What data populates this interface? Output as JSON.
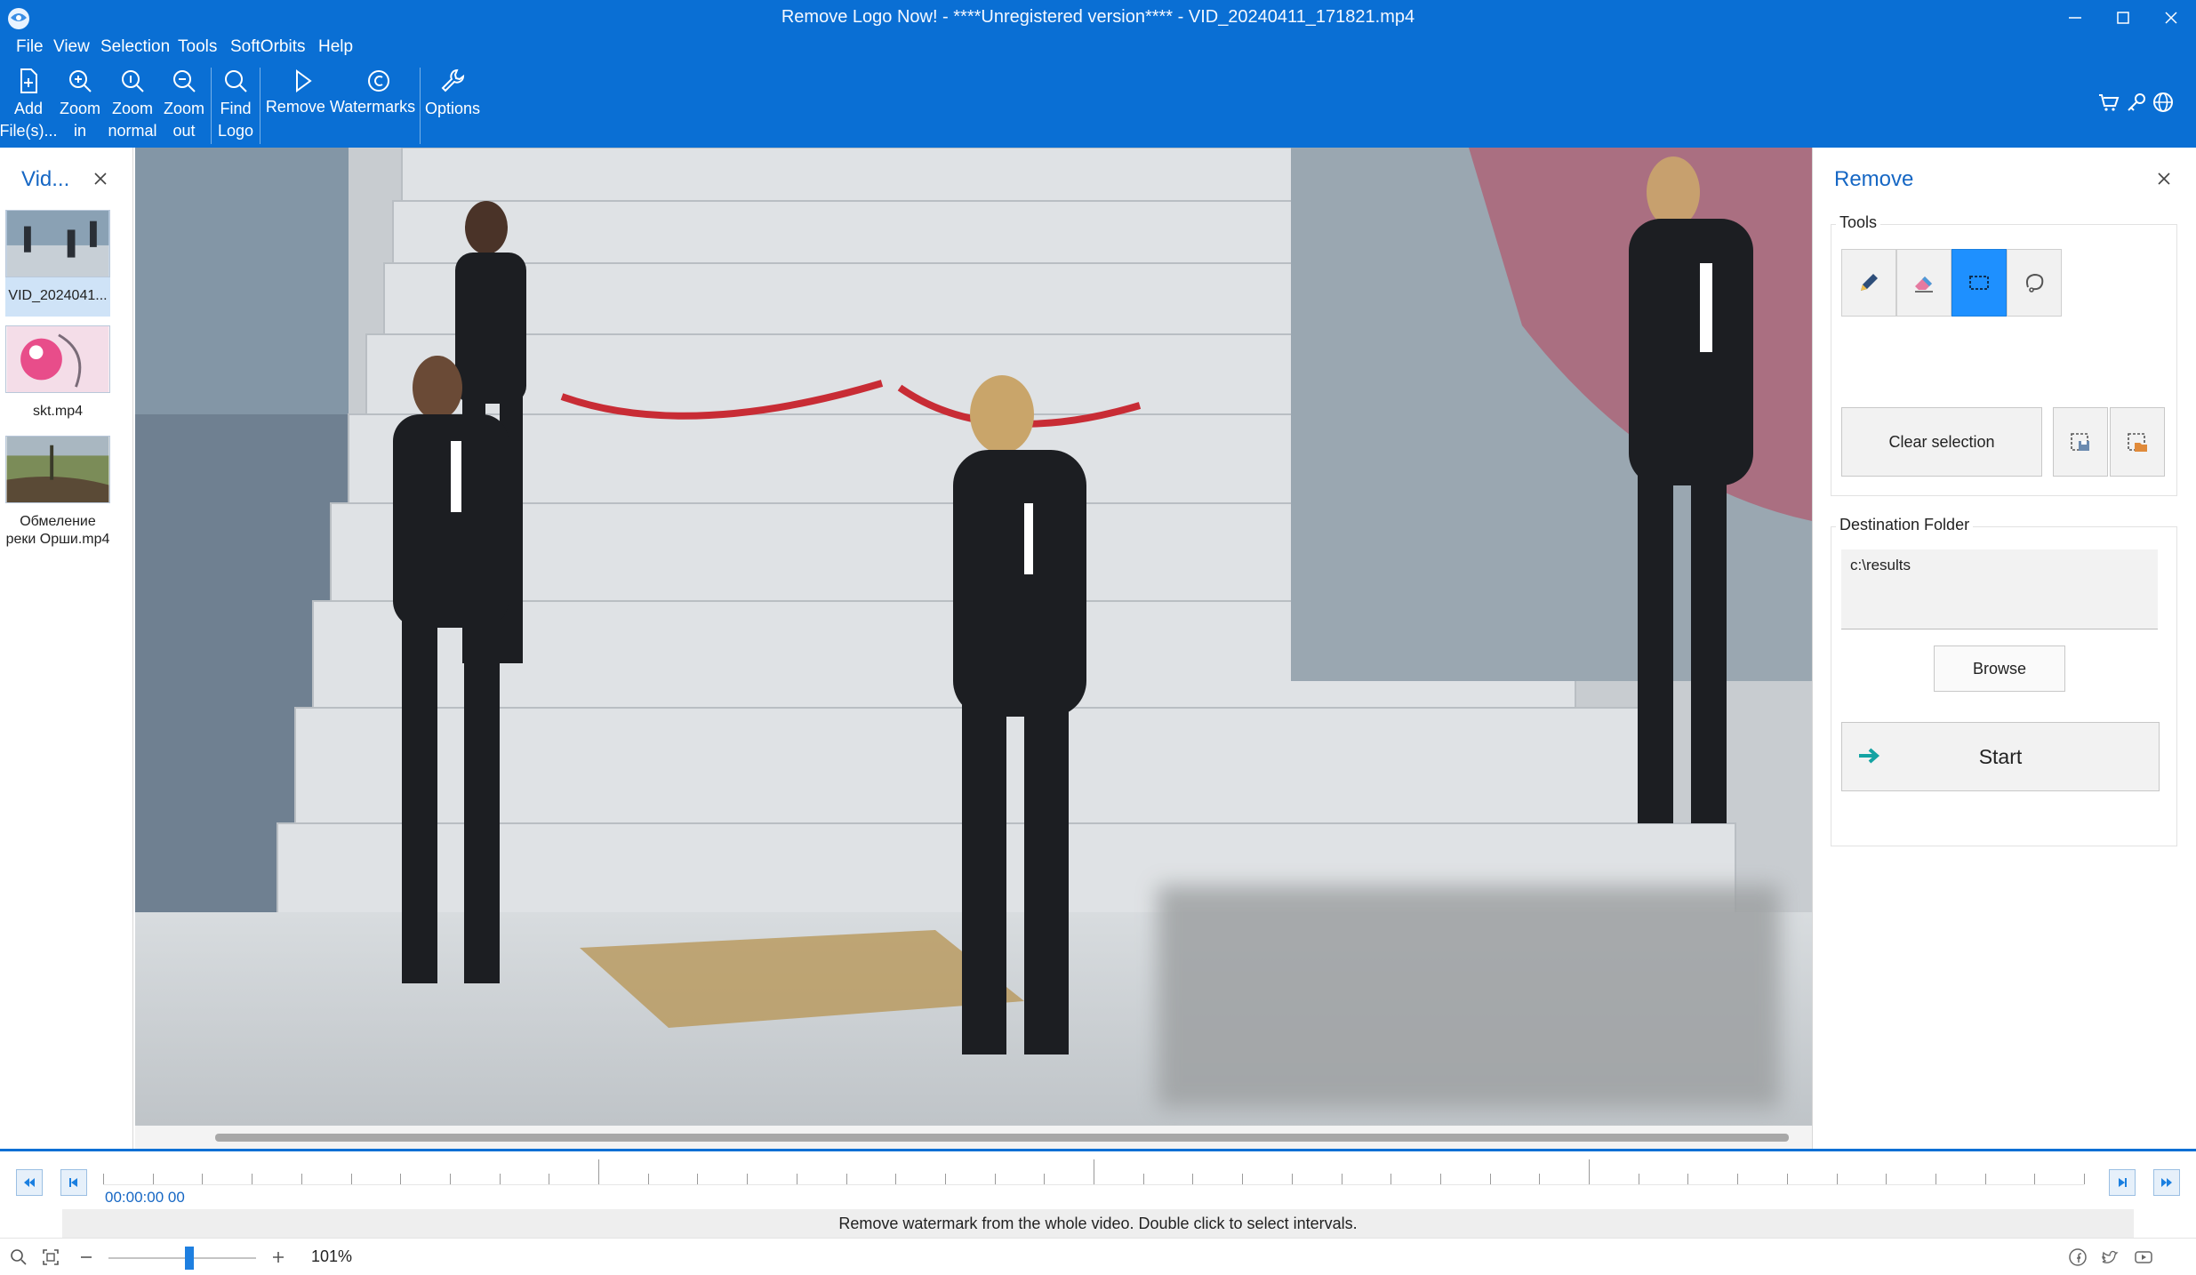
{
  "window": {
    "title": "Remove Logo Now! - ****Unregistered version**** - VID_20240411_171821.mp4"
  },
  "menu": {
    "file": "File",
    "view": "View",
    "selection": "Selection",
    "tools": "Tools",
    "softorbits": "SoftOrbits",
    "help": "Help"
  },
  "ribbon": {
    "add_files": [
      "Add",
      "File(s)..."
    ],
    "zoom_in": [
      "Zoom",
      "in"
    ],
    "zoom_normal": [
      "Zoom",
      "normal"
    ],
    "zoom_out": [
      "Zoom",
      "out"
    ],
    "find_logo": [
      "Find",
      "Logo"
    ],
    "remove_watermarks": "Remove Watermarks",
    "options": "Options"
  },
  "left_panel": {
    "title": "Vid...",
    "files": [
      {
        "name": "VID_2024041...",
        "selected": true
      },
      {
        "name": "skt.mp4",
        "selected": false
      },
      {
        "name": "Обмеление реки Орши.mp4",
        "selected": false
      }
    ]
  },
  "right_panel": {
    "title": "Remove",
    "tools_label": "Tools",
    "tools": [
      "pencil-icon",
      "eraser-icon",
      "rectangle-select-icon",
      "lasso-icon"
    ],
    "active_tool": "rectangle-select-icon",
    "clear_selection": "Clear selection",
    "destination_label": "Destination Folder",
    "destination_value": "c:\\results",
    "browse": "Browse",
    "start": "Start"
  },
  "timeline": {
    "time": "00:00:00 00",
    "hint": "Remove watermark from the whole video. Double click to select intervals."
  },
  "status": {
    "zoom": "101%",
    "zoom_fraction": 0.55
  },
  "colors": {
    "accent": "#0a6fd4",
    "active_tool": "#1e90ff",
    "start_arrow": "#14a3a3"
  }
}
